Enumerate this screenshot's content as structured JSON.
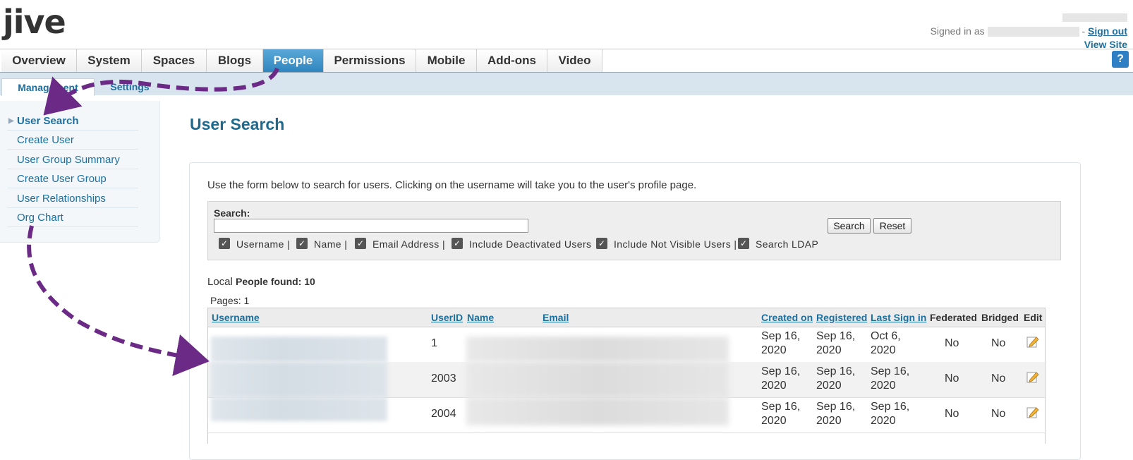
{
  "header": {
    "logo": "jive",
    "signed_in_prefix": "Signed in as",
    "sign_out": "Sign out",
    "view_site": "View Site",
    "separator": "-"
  },
  "nav": {
    "tabs": [
      {
        "label": "Overview"
      },
      {
        "label": "System"
      },
      {
        "label": "Spaces"
      },
      {
        "label": "Blogs"
      },
      {
        "label": "People",
        "active": true
      },
      {
        "label": "Permissions"
      },
      {
        "label": "Mobile"
      },
      {
        "label": "Add-ons"
      },
      {
        "label": "Video"
      }
    ],
    "help": "?"
  },
  "subnav": {
    "tabs": [
      {
        "label": "Management",
        "active": true
      },
      {
        "label": "Settings"
      }
    ]
  },
  "sidebar": {
    "items": [
      {
        "label": "User Search",
        "active": true
      },
      {
        "label": "Create User"
      },
      {
        "label": "User Group Summary"
      },
      {
        "label": "Create User Group"
      },
      {
        "label": "User Relationships"
      },
      {
        "label": "Org Chart"
      }
    ]
  },
  "main": {
    "title": "User Search",
    "intro": "Use the form below to search for users. Clicking on the username will take you to the user's profile page.",
    "search": {
      "label": "Search:",
      "value": "",
      "search_button": "Search",
      "reset_button": "Reset",
      "options": [
        {
          "label": "Username |",
          "checked": true
        },
        {
          "label": "Name |",
          "checked": true
        },
        {
          "label": "Email Address |",
          "checked": true
        },
        {
          "label": "Include Deactivated Users",
          "checked": true
        },
        {
          "label": "Include Not Visible Users |",
          "checked": true
        },
        {
          "label": "Search LDAP",
          "checked": true
        }
      ]
    },
    "found_prefix": "Local",
    "found_label": "People found: 10",
    "pages": "Pages: 1",
    "table": {
      "headers": [
        "Username",
        "UserID",
        "Name",
        "Email",
        "Created on",
        "Registered",
        "Last Sign in",
        "Federated",
        "Bridged",
        "Edit"
      ],
      "rows": [
        {
          "userid": "1",
          "created": "Sep 16, 2020",
          "registered": "Sep 16, 2020",
          "last": "Oct 6, 2020",
          "federated": "No",
          "bridged": "No"
        },
        {
          "userid": "2003",
          "created": "Sep 16, 2020",
          "registered": "Sep 16, 2020",
          "last": "Sep 16, 2020",
          "federated": "No",
          "bridged": "No"
        },
        {
          "userid": "2004",
          "created": "Sep 16, 2020",
          "registered": "Sep 16, 2020",
          "last": "Sep 16, 2020",
          "federated": "No",
          "bridged": "No"
        }
      ]
    }
  },
  "colors": {
    "accent": "#2f86bf",
    "link": "#1d6fa0",
    "annotation_arrow": "#6a2a86"
  }
}
